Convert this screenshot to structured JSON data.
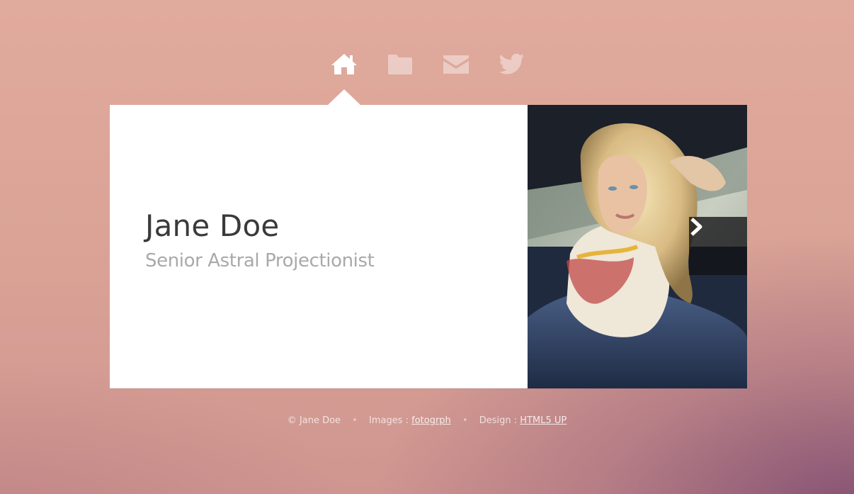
{
  "nav": {
    "items": [
      {
        "icon": "home-icon",
        "label": "Home",
        "active": true
      },
      {
        "icon": "folder-icon",
        "label": "Work",
        "active": false
      },
      {
        "icon": "envelope-icon",
        "label": "Contact",
        "active": false
      },
      {
        "icon": "twitter-icon",
        "label": "Twitter",
        "active": false
      }
    ]
  },
  "profile": {
    "name": "Jane Doe",
    "title": "Senior Astral Projectionist"
  },
  "photo": {
    "next_icon": "chevron-right-icon"
  },
  "footer": {
    "copyright": "© Jane Doe",
    "images_label": "Images :",
    "images_link": "fotogrph",
    "design_label": "Design :",
    "design_link": "HTML5 UP",
    "separator": "•"
  },
  "colors": {
    "background": "#dba598",
    "card": "#ffffff",
    "name_text": "#3a3a3a",
    "title_text": "#a9a9ac"
  }
}
